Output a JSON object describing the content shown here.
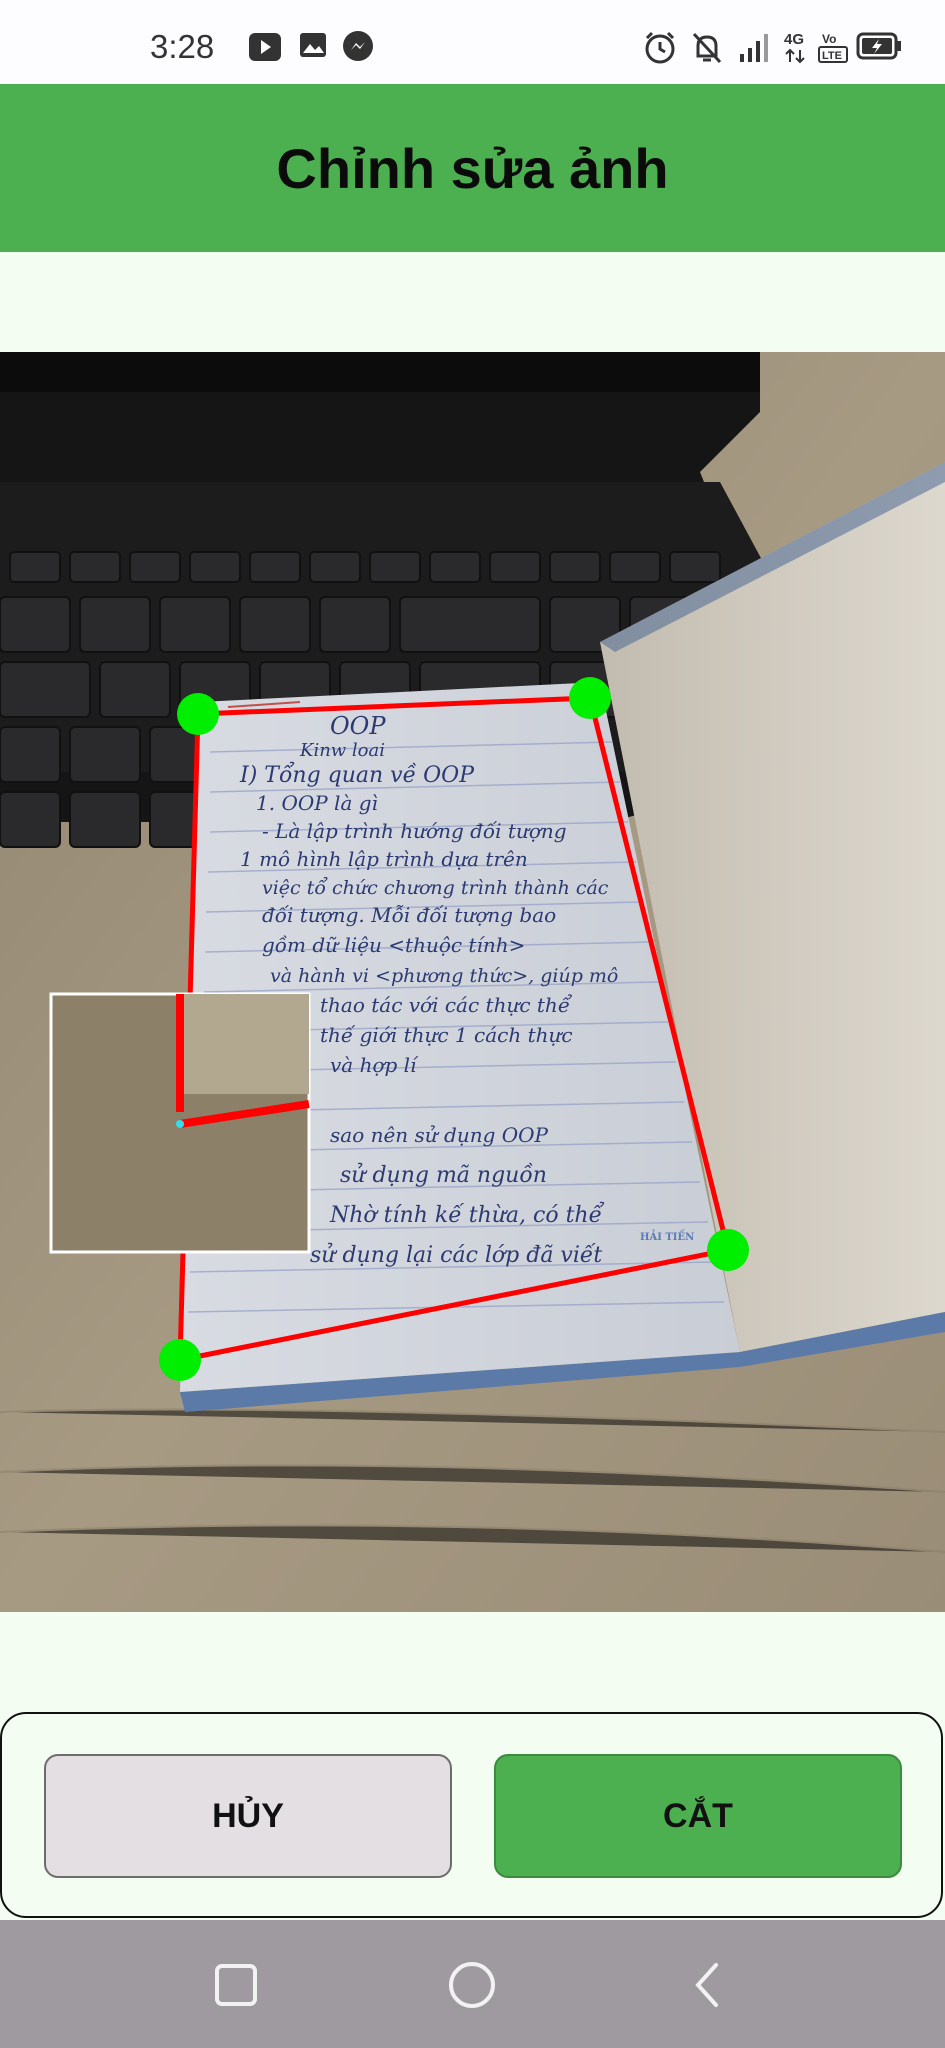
{
  "status_bar": {
    "time": "3:28",
    "left_icons": [
      "video-app-icon",
      "gallery-icon",
      "messenger-icon"
    ],
    "right_icons": [
      "alarm-icon",
      "bell-off-icon",
      "signal-icon",
      "4g-icon",
      "volte-icon",
      "battery-icon"
    ],
    "network": "4G",
    "volte": "Vo LTE"
  },
  "app_bar": {
    "title": "Chỉnh sửa ảnh",
    "color": "#4caf50"
  },
  "photo": {
    "notebook_lines": [
      "OOP",
      "Kinw loai",
      "I) Tổng quan về OOP",
      "1. OOP là gì",
      "- Là lập trình hướng đối tượng",
      "1 mô hình lập trình dựa trên",
      "việc tổ chức chương trình thành các",
      "đối tượng. Mỗi đối tượng bao",
      "gồm dữ liệu <thuộc tính>",
      "và hành vi <phương thức>, giúp mô",
      "thao tác với các thực thể",
      "thế giới thực 1 cách thực",
      "và hợp lí",
      "sao nên sử dụng OOP",
      "sử dụng mã nguồn",
      "Nhờ tính kế thừa, có thể",
      "sử dụng lại các lớp đã viết"
    ],
    "notebook_brand": "HẢI TIẾN",
    "corner_color": "#00ee00",
    "crop_line_color": "#ff0000"
  },
  "actions": {
    "cancel_label": "HỦY",
    "crop_label": "CẮT"
  },
  "nav_bar": {
    "icons": [
      "recents-icon",
      "home-icon",
      "back-icon"
    ]
  }
}
